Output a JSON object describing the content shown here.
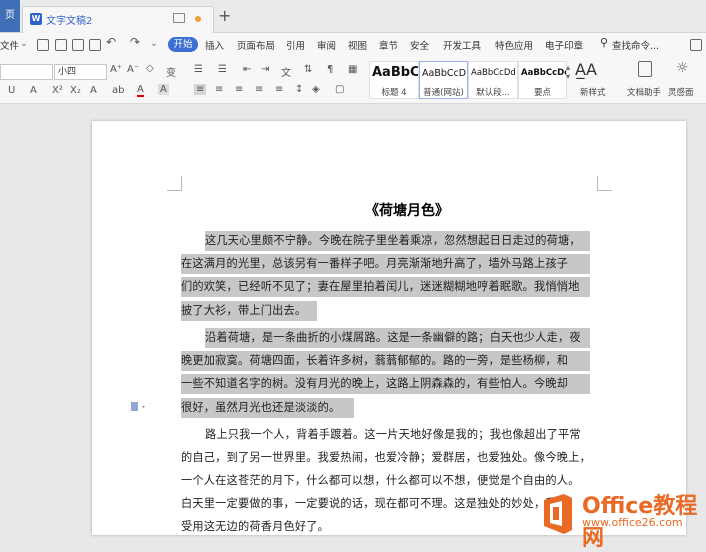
{
  "tabs": {
    "home": "页",
    "doc_title": "文字文稿2",
    "new_tab": "+"
  },
  "menu": {
    "file": "文件",
    "start": "开始",
    "items": [
      "插入",
      "页面布局",
      "引用",
      "审阅",
      "视图",
      "章节",
      "安全",
      "开发工具",
      "特色应用",
      "电子印章"
    ],
    "search": "查找命令..."
  },
  "ribbon": {
    "font_size": "小四",
    "styles": [
      {
        "sample": "AaBbC",
        "label": "标题 4"
      },
      {
        "sample": "AaBbCcD",
        "label": "普通(网站)"
      },
      {
        "sample": "AaBbCcDd",
        "label": "默认段..."
      },
      {
        "sample": "AaBbCcDd",
        "label": "要点"
      }
    ],
    "new_style": "新样式",
    "doc_assistant": "文档助手",
    "inspiration": "灵感面"
  },
  "document": {
    "title": "《荷塘月色》",
    "lines": [
      "这几天心里颇不宁静。今晚在院子里坐着乘凉，忽然想起日日走过的荷塘，",
      "在这满月的光里，总该另有一番样子吧。月亮渐渐地升高了，墙外马路上孩子",
      "们的欢笑，已经听不见了；妻在屋里拍着闰儿，迷迷糊糊地哼着眠歌。我悄悄地",
      "披了大衫，带上门出去。",
      "沿着荷塘，是一条曲折的小煤屑路。这是一条幽僻的路；白天也少人走，夜",
      "晚更加寂寞。荷塘四面，长着许多树，蓊蓊郁郁的。路的一旁，是些杨柳，和",
      "一些不知道名字的树。没有月光的晚上，这路上阴森森的，有些怕人。今晚却",
      "很好，虽然月光也还是淡淡的。",
      "路上只我一个人，背着手踱着。这一片天地好像是我的；我也像超出了平常",
      "的自己，到了另一世界里。我爱热闹，也爱冷静；爱群居，也爱独处。像今晚上，",
      "一个人在这苍茫的月下，什么都可以想，什么都可以不想，便觉是个自由的人。",
      "白天里一定要做的事，一定要说的话，现在都可不理。这是独处的妙处，我且",
      "受用这无边的荷香月色好了。"
    ]
  },
  "watermark": {
    "brand": "Office教程网",
    "url": "www.office26.com"
  },
  "colors": {
    "accent": "#3c6fd1",
    "highlight": "#c7c7c7",
    "watermark": "#e86a24"
  }
}
